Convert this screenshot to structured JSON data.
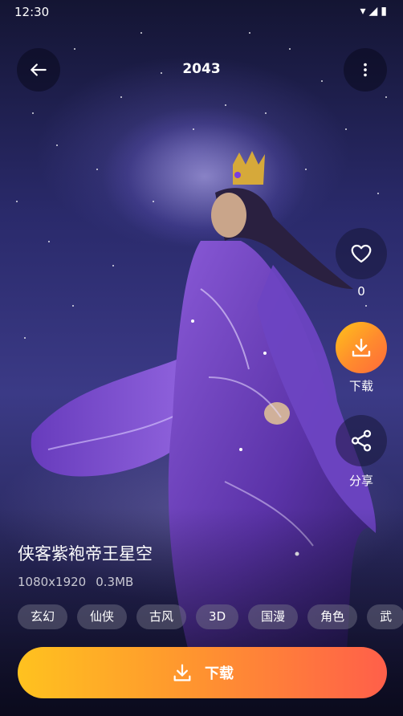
{
  "status_bar": {
    "time": "12:30",
    "icons": [
      "wifi-icon",
      "signal-icon",
      "battery-icon"
    ]
  },
  "header": {
    "title": "2043",
    "back_icon": "arrow-left-icon",
    "more_icon": "more-vertical-icon"
  },
  "actions": {
    "favorite": {
      "icon": "heart-icon",
      "count": "0"
    },
    "download": {
      "icon": "download-icon",
      "label": "下载",
      "accent": "#ff9a2a"
    },
    "share": {
      "icon": "share-icon",
      "label": "分享"
    }
  },
  "wallpaper": {
    "title": "侠客紫袍帝王星空",
    "resolution": "1080x1920",
    "size": "0.3MB",
    "tags": [
      "玄幻",
      "仙侠",
      "古风",
      "3D",
      "国漫",
      "角色",
      "武"
    ]
  },
  "download_button": {
    "label": "下载",
    "icon": "download-icon",
    "gradient": [
      "#ffc21f",
      "#ff5f4a"
    ]
  }
}
